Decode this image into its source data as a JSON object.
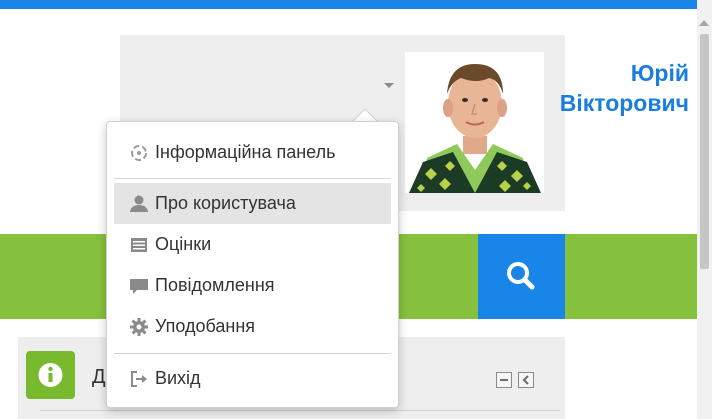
{
  "user": {
    "name_first": "Юрій",
    "name_last": "Вікторович"
  },
  "menu": {
    "items": [
      {
        "label": "Інформаційна панель",
        "icon": "dashboard-icon"
      },
      {
        "label": "Про користувача",
        "icon": "user-icon",
        "active": true
      },
      {
        "label": "Оцінки",
        "icon": "grades-table-icon"
      },
      {
        "label": "Повідомлення",
        "icon": "message-bubble-icon"
      },
      {
        "label": "Уподобання",
        "icon": "gear-icon"
      },
      {
        "label": "Вихід",
        "icon": "logout-icon"
      }
    ]
  },
  "block": {
    "title_visible": "Д"
  },
  "colors": {
    "accent_blue": "#1a85e8",
    "name_blue": "#1a7ee0",
    "brand_green": "#86c13d",
    "info_green": "#78b92e"
  }
}
